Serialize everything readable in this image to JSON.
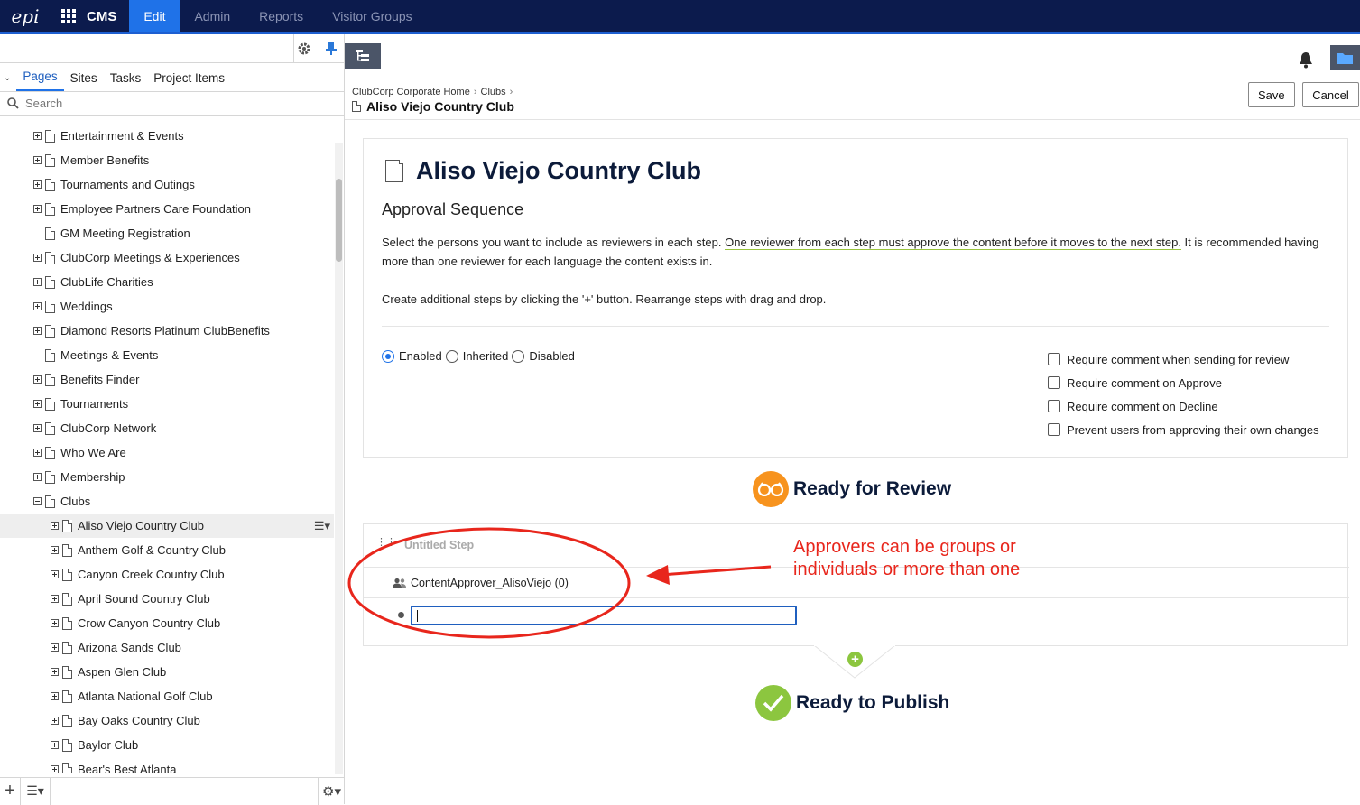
{
  "topbar": {
    "product": "CMS",
    "tabs": [
      "Edit",
      "Admin",
      "Reports",
      "Visitor Groups"
    ],
    "active_tab": "Edit"
  },
  "left_panel": {
    "tabs": [
      "Pages",
      "Sites",
      "Tasks",
      "Project Items"
    ],
    "active_tab": "Pages",
    "search_placeholder": "Search",
    "tree": [
      {
        "label": "Entertainment & Events",
        "level": 0,
        "expander": "plus"
      },
      {
        "label": "Member Benefits",
        "level": 0,
        "expander": "plus"
      },
      {
        "label": "Tournaments and Outings",
        "level": 0,
        "expander": "plus"
      },
      {
        "label": "Employee Partners Care Foundation",
        "level": 0,
        "expander": "plus"
      },
      {
        "label": "GM Meeting Registration",
        "level": 0,
        "expander": "none"
      },
      {
        "label": "ClubCorp Meetings & Experiences",
        "level": 0,
        "expander": "plus"
      },
      {
        "label": "ClubLife Charities",
        "level": 0,
        "expander": "plus"
      },
      {
        "label": "Weddings",
        "level": 0,
        "expander": "plus"
      },
      {
        "label": "Diamond Resorts Platinum ClubBenefits",
        "level": 0,
        "expander": "plus"
      },
      {
        "label": "Meetings & Events",
        "level": 0,
        "expander": "none"
      },
      {
        "label": "Benefits Finder",
        "level": 0,
        "expander": "plus"
      },
      {
        "label": "Tournaments",
        "level": 0,
        "expander": "plus"
      },
      {
        "label": "ClubCorp Network",
        "level": 0,
        "expander": "plus"
      },
      {
        "label": "Who We Are",
        "level": 0,
        "expander": "plus"
      },
      {
        "label": "Membership",
        "level": 0,
        "expander": "plus"
      },
      {
        "label": "Clubs",
        "level": 0,
        "expander": "minus"
      },
      {
        "label": "Aliso Viejo Country Club",
        "level": 1,
        "expander": "plus",
        "selected": true
      },
      {
        "label": "Anthem Golf & Country Club",
        "level": 1,
        "expander": "plus"
      },
      {
        "label": "Canyon Creek Country Club",
        "level": 1,
        "expander": "plus"
      },
      {
        "label": "April Sound Country Club",
        "level": 1,
        "expander": "plus"
      },
      {
        "label": "Crow Canyon Country Club",
        "level": 1,
        "expander": "plus"
      },
      {
        "label": "Arizona Sands Club",
        "level": 1,
        "expander": "plus"
      },
      {
        "label": "Aspen Glen Club",
        "level": 1,
        "expander": "plus"
      },
      {
        "label": "Atlanta National Golf Club",
        "level": 1,
        "expander": "plus"
      },
      {
        "label": "Bay Oaks Country Club",
        "level": 1,
        "expander": "plus"
      },
      {
        "label": "Baylor Club",
        "level": 1,
        "expander": "plus"
      },
      {
        "label": "Bear's Best Atlanta",
        "level": 1,
        "expander": "plus"
      }
    ]
  },
  "breadcrumb": {
    "items": [
      "ClubCorp Corporate Home",
      "Clubs"
    ],
    "current": "Aliso Viejo Country Club"
  },
  "actions": {
    "save": "Save",
    "cancel": "Cancel"
  },
  "approval": {
    "page_title": "Aliso Viejo Country Club",
    "heading": "Approval Sequence",
    "desc_part1": "Select the persons you want to include as reviewers in each step. ",
    "desc_link": "One reviewer from each step must approve the content before it moves to the next step.",
    "desc_part2": " It is recommended having more than one reviewer for each language the content exists in.",
    "desc_line2": "Create additional steps by clicking the '+' button. Rearrange steps with drag and drop.",
    "radios": [
      "Enabled",
      "Inherited",
      "Disabled"
    ],
    "selected_radio": "Enabled",
    "checkboxes": [
      "Require comment when sending for review",
      "Require comment on Approve",
      "Require comment on Decline",
      "Prevent users from approving their own changes"
    ]
  },
  "workflow": {
    "ready_review": "Ready for Review",
    "step_title": "Untitled Step",
    "approver": "ContentApprover_AlisoViejo (0)",
    "ready_publish": "Ready to Publish",
    "review_color": "#f7931e",
    "publish_color": "#8cc63f"
  },
  "annotation": {
    "text": "Approvers can be groups or individuals or more than one",
    "color": "#e8261c"
  }
}
